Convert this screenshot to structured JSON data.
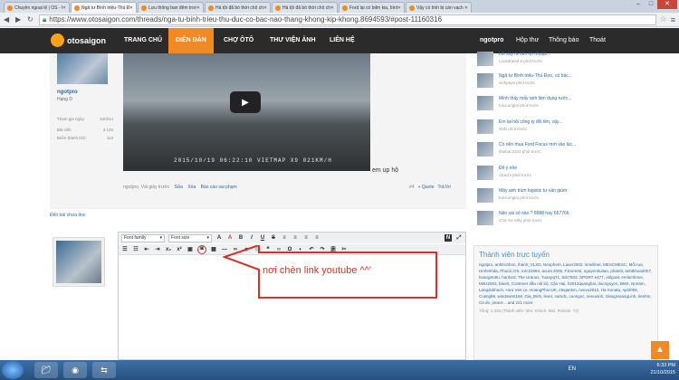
{
  "tabs": [
    {
      "label": "Chuyên ngoại lệ | OS - Ch..."
    },
    {
      "label": "Ngã tư Bình triệu-Thủ Đức..."
    },
    {
      "label": "Lưu thông ban đêm trong..."
    },
    {
      "label": "Hà tội đã bỏ thời chỗ cho..."
    },
    {
      "label": "Hà tội đã bỏ thời chỗ cho..."
    },
    {
      "label": "Ford lại có biển kia, bình..."
    },
    {
      "label": "Vậy có tình bị cán vạch li..."
    }
  ],
  "address": {
    "url": "https://www.otosaigon.com/threads/nga-tu-binh-trieu-thu-duc-co-bac-nao-thang-khong-kip-khong.8694593/#post-11160316"
  },
  "site": {
    "logo_text": "otosaigon",
    "nav": [
      "TRANG CHỦ",
      "DIỄN ĐÀN",
      "CHỢ ÔTÔ",
      "THƯ VIỆN ẢNH",
      "LIÊN HỆ"
    ],
    "user_menu": [
      "ngotpro",
      "Hộp thư",
      "Thông báo",
      "Thoát"
    ]
  },
  "post": {
    "username": "ngotpro",
    "rank": "Hạng D",
    "stats": [
      {
        "label": "Tham gia ngày:",
        "value": "16/3/14"
      },
      {
        "label": "Bài viết:",
        "value": "3.120"
      },
      {
        "label": "Điểm thành tích:",
        "value": "113"
      }
    ],
    "video_stamp": "2015/10/19 06:22:10 VIETMAP X9 021KM/H",
    "text": "em up hộ",
    "footer_author": "ngotpro, Vài giây trước",
    "footer_actions": [
      "Sửa",
      "Xóa",
      "Báo cáo sai phạm"
    ],
    "post_number": "#4",
    "quote": "+ Quote",
    "reply": "Trả lời",
    "unread_link": "Đến bài chưa đọc"
  },
  "editor": {
    "font_family": "Font family",
    "font_size": "Font size",
    "annotation": "nơi chèn link youtube ^^'"
  },
  "sidebar": {
    "items": [
      {
        "title": "Lỗi xảy ra tiền lợi nhuận...",
        "meta": "Lookahead 6 phút trước"
      },
      {
        "title": "Ngã tư Bình triệu-Thủ Đức, có bác...",
        "meta": "vinhpaye phút trước"
      },
      {
        "title": "Minh thấy mấy anh làm dụng rước...",
        "meta": "tutucungtoi phút trước"
      },
      {
        "title": "Em lại hỏi công ty đổi tên, vậy...",
        "meta": "N2D phút trước"
      },
      {
        "title": "Có nên mua Ford Focus mới vào lúc...",
        "meta": "thoibac3103 phút trước"
      },
      {
        "title": "Để ý nhé",
        "meta": "Abachi phút trước"
      },
      {
        "title": "Mấy anh trùm logistic tư vấn giùm",
        "meta": "tutucungtoi phút trước"
      },
      {
        "title": "Nên sài số nào ? 8888 hay 667766",
        "meta": "Chờ Sợ Mây phút trước"
      }
    ],
    "online_title": "Thành viên trực tuyến",
    "online_users": "ngotpro, anhtronhon, thanh_VLXD, Neophem, Laser2002, smellinet, MESCMESC, Mối rua, Hmhmhda, Phucic.OS, mrc21984, acura 2005, F.Everest, nguyenbuitan, phantit, anhtkhoa2007, hoangtruttu, hanford, The Uranus, Tuanpq71, ttck7503, SPORT e477, oldgoat, emlamhmei, Melz2003, baont, Contener dầu nội bộ, Cậu Hai, h2012quanghai, ducnguyen, BMX, Nnnam, Langdukhach, Hưu Viet Le, HoangPhucUK, elegantvn, nvuvu2012, Ha Sonata, npt2006, Cuting69, windowmt166, Gia_Binh, lever, namdc, cuongvc, nenuvinh, GiangHoangLinh, tienhm, Ca de, peace ...and 221 more",
    "online_total": "Tổng: 1.326 (Thành viên: 304, Khách: 982, Robots: 72)"
  },
  "taskbar": {
    "lang": "EN",
    "time": "6:33 PM",
    "date": "21/10/2015"
  }
}
